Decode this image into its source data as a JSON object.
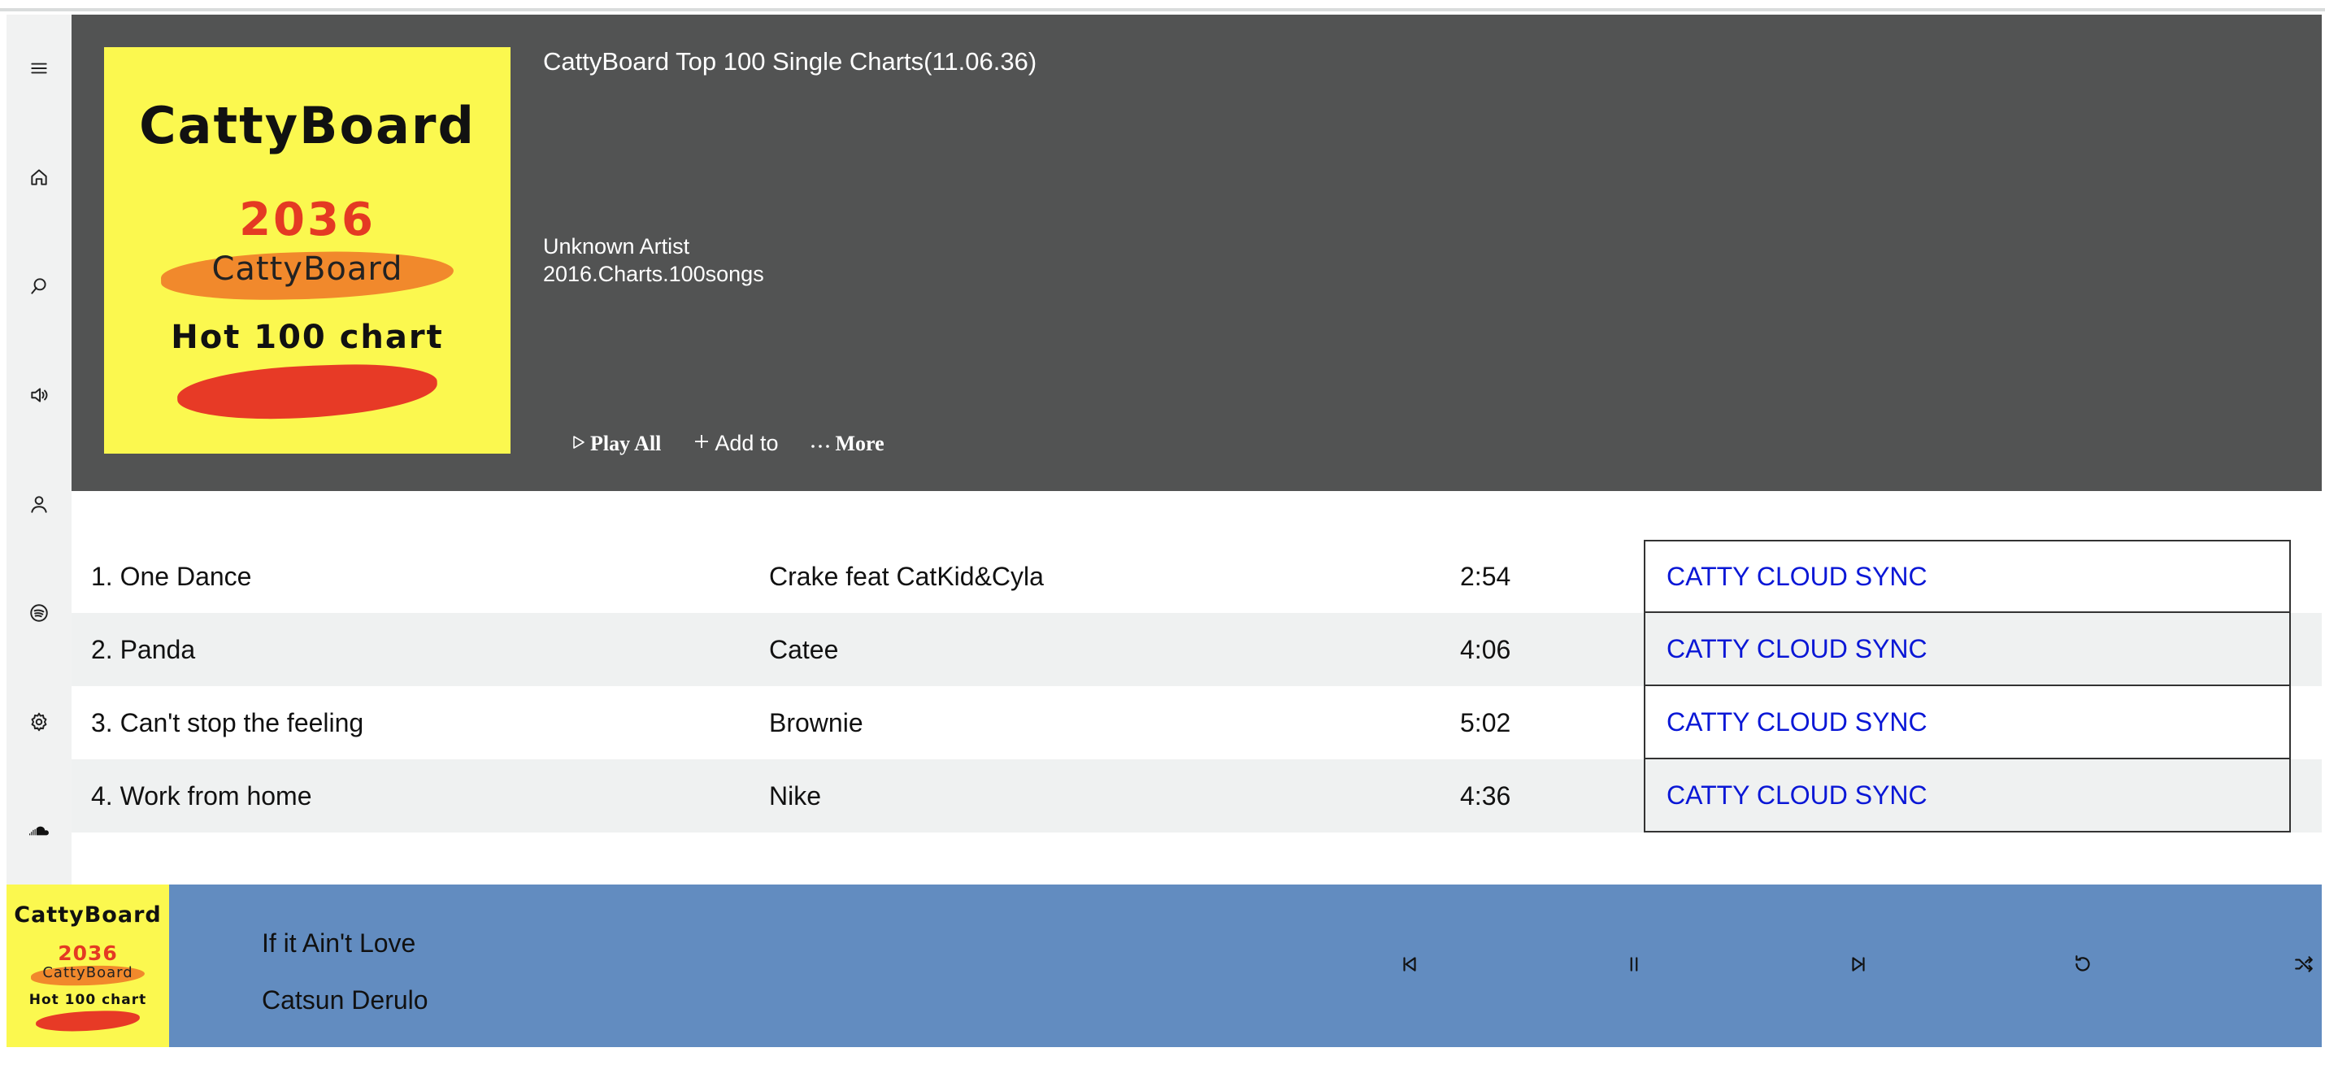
{
  "header": {
    "title": "CattyBoard Top 100 Single Charts(11.06.36)",
    "artist": "Unknown Artist",
    "subtitle": "2016.Charts.100songs",
    "actions": {
      "play_all": "Play All",
      "add_to": "Add to",
      "more": "More"
    }
  },
  "cover": {
    "brand": "CattyBoard",
    "year": "2036",
    "brand_sub": "CattyBoard",
    "chart_name": "Hot 100 chart"
  },
  "sidebar": {
    "icons": [
      "menu-icon",
      "home-icon",
      "search-icon",
      "volume-icon",
      "user-icon",
      "spotify-icon",
      "settings-icon",
      "soundcloud-icon"
    ]
  },
  "tracks": [
    {
      "title": "1. One Dance",
      "artist": "Crake feat CatKid&Cyla",
      "duration": "2:54",
      "action": "CATTY CLOUD SYNC"
    },
    {
      "title": "2. Panda",
      "artist": "Catee",
      "duration": "4:06",
      "action": "CATTY CLOUD SYNC"
    },
    {
      "title": "3. Can't stop the feeling",
      "artist": "Brownie",
      "duration": "5:02",
      "action": "CATTY CLOUD SYNC"
    },
    {
      "title": "4. Work from home",
      "artist": "Nike",
      "duration": "4:36",
      "action": "CATTY CLOUD SYNC"
    }
  ],
  "player": {
    "song": "If it Ain't Love",
    "artist": "Catsun Derulo",
    "controls": [
      "previous-icon",
      "pause-icon",
      "next-icon",
      "repeat-icon",
      "shuffle-icon"
    ]
  },
  "colors": {
    "header_bg": "#525353",
    "sidebar_bg": "#f1f2f2",
    "player_bg": "#628cc0",
    "cover_bg": "#fbf84f",
    "link": "#0a17d6",
    "alt_row": "#eff1f1"
  }
}
